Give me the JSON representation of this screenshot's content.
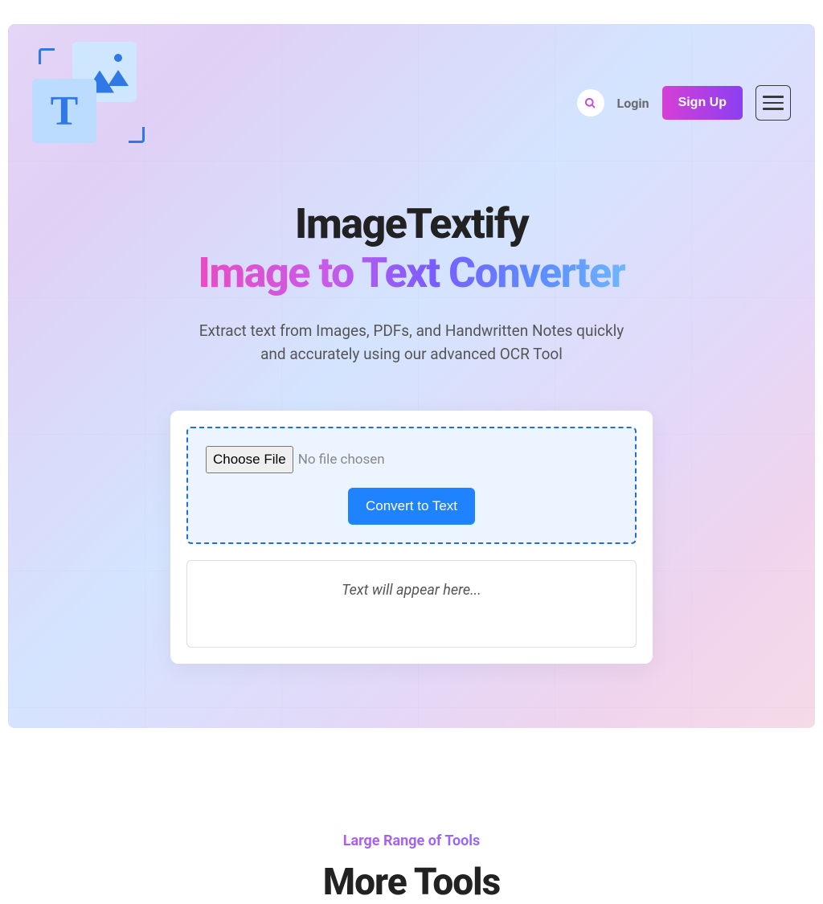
{
  "nav": {
    "login_label": "Login",
    "signup_label": "Sign Up"
  },
  "hero": {
    "title_main": "ImageTextify",
    "title_sub": "Image to Text Converter",
    "subtitle": "Extract text from Images, PDFs, and Handwritten Notes quickly and accurately using our advanced OCR Tool"
  },
  "tool": {
    "choose_file_label": "Choose File",
    "no_file_text": "No file chosen",
    "convert_label": "Convert to Text",
    "output_placeholder": "Text will appear here..."
  },
  "more": {
    "range_label": "Large Range of Tools",
    "title": "More Tools"
  }
}
